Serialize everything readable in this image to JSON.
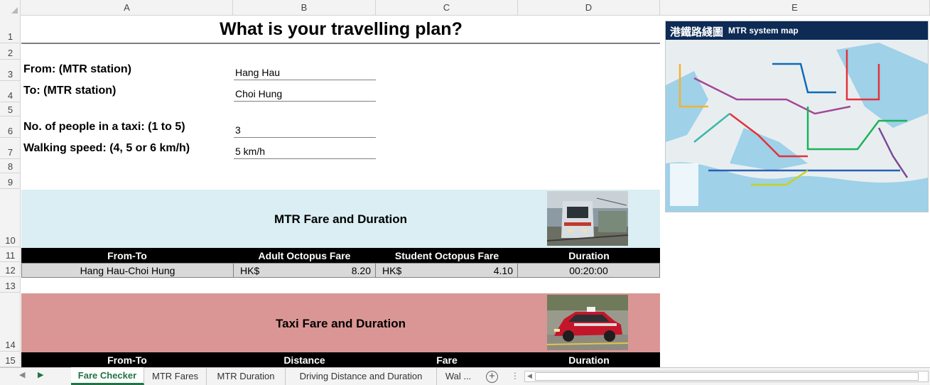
{
  "columns": [
    "A",
    "B",
    "C",
    "D",
    "E"
  ],
  "rows": [
    "1",
    "2",
    "3",
    "4",
    "5",
    "6",
    "7",
    "8",
    "9",
    "10",
    "11",
    "12",
    "13",
    "14",
    "15"
  ],
  "title": "What is your travelling plan?",
  "inputs": {
    "from_label": "From: (MTR station)",
    "from_value": "Hang Hau",
    "to_label": "To: (MTR station)",
    "to_value": "Choi Hung",
    "people_label": "No. of people in a taxi: (1 to 5)",
    "people_value": "3",
    "walk_label": "Walking speed: (4, 5 or 6 km/h)",
    "walk_value": "5 km/h"
  },
  "mtr": {
    "title": "MTR Fare and Duration",
    "headers": [
      "From-To",
      "Adult Octopus Fare",
      "Student Octopus Fare",
      "Duration"
    ],
    "row": {
      "from_to": "Hang Hau-Choi Hung",
      "adult_currency": "HK$",
      "adult_fare": "8.20",
      "student_currency": "HK$",
      "student_fare": "4.10",
      "duration": "00:20:00"
    }
  },
  "taxi": {
    "title": "Taxi Fare and Duration",
    "headers": [
      "From-To",
      "Distance",
      "Fare",
      "Duration"
    ]
  },
  "map": {
    "title_zh": "港鐵路綫圖",
    "title_en": "MTR system map"
  },
  "sheet_tabs": [
    "Fare Checker",
    "MTR Fares",
    "MTR Duration",
    "Driving Distance and Duration",
    "Wal ..."
  ],
  "active_tab": "Fare Checker",
  "colors": {
    "mtr_band": "#daeef3",
    "taxi_band": "#da9694",
    "header_black": "#000000",
    "data_row": "#d9d9d9",
    "excel_green": "#217346"
  }
}
